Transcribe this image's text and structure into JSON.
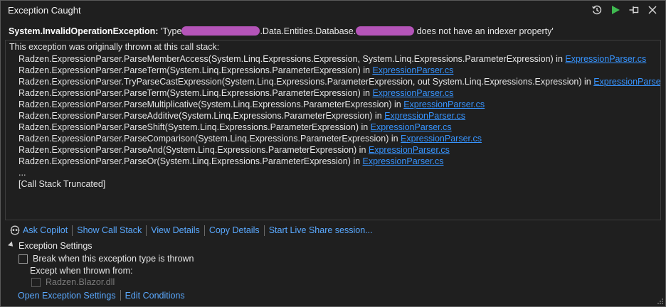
{
  "window": {
    "title": "Exception Caught"
  },
  "exception": {
    "type": "System.InvalidOperationException:",
    "msg_part1": " 'Type",
    "msg_part2": ".Data.Entities.Database.",
    "msg_part3": " does not have an indexer property'"
  },
  "stack": {
    "intro": "This exception was originally thrown at this call stack:",
    "frames": [
      {
        "text": "Radzen.ExpressionParser.ParseMemberAccess(System.Linq.Expressions.Expression, System.Linq.Expressions.ParameterExpression) in ",
        "file": "ExpressionParser.cs"
      },
      {
        "text": "Radzen.ExpressionParser.ParseTerm(System.Linq.Expressions.ParameterExpression) in ",
        "file": "ExpressionParser.cs"
      },
      {
        "text": "Radzen.ExpressionParser.TryParseCastExpression(System.Linq.Expressions.ParameterExpression, out System.Linq.Expressions.Expression) in ",
        "file": "ExpressionParser.cs"
      },
      {
        "text": "Radzen.ExpressionParser.ParseTerm(System.Linq.Expressions.ParameterExpression) in ",
        "file": "ExpressionParser.cs"
      },
      {
        "text": "Radzen.ExpressionParser.ParseMultiplicative(System.Linq.Expressions.ParameterExpression) in ",
        "file": "ExpressionParser.cs"
      },
      {
        "text": "Radzen.ExpressionParser.ParseAdditive(System.Linq.Expressions.ParameterExpression) in ",
        "file": "ExpressionParser.cs"
      },
      {
        "text": "Radzen.ExpressionParser.ParseShift(System.Linq.Expressions.ParameterExpression) in ",
        "file": "ExpressionParser.cs"
      },
      {
        "text": "Radzen.ExpressionParser.ParseComparison(System.Linq.Expressions.ParameterExpression) in ",
        "file": "ExpressionParser.cs"
      },
      {
        "text": "Radzen.ExpressionParser.ParseAnd(System.Linq.Expressions.ParameterExpression) in ",
        "file": "ExpressionParser.cs"
      },
      {
        "text": "Radzen.ExpressionParser.ParseOr(System.Linq.Expressions.ParameterExpression) in ",
        "file": "ExpressionParser.cs"
      }
    ],
    "ellipsis": "...",
    "truncated": "[Call Stack Truncated]"
  },
  "actions": {
    "ask_copilot": "Ask Copilot",
    "show_call_stack": "Show Call Stack",
    "view_details": "View Details",
    "copy_details": "Copy Details",
    "live_share": "Start Live Share session..."
  },
  "settings": {
    "header": "Exception Settings",
    "break_label": "Break when this exception type is thrown",
    "except_label": "Except when thrown from:",
    "dll_label": "Radzen.Blazor.dll",
    "open_settings": "Open Exception Settings",
    "edit_conditions": "Edit Conditions"
  },
  "colors": {
    "background": "#1f1f1f",
    "link": "#3794ff",
    "run_green": "#3fb950",
    "redaction": "#b454b8"
  },
  "icons": {
    "history": "history-icon",
    "continue": "play-icon",
    "pin": "pin-icon",
    "close": "close-icon",
    "copilot": "copilot-icon"
  }
}
